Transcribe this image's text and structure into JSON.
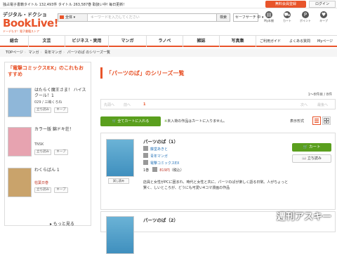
{
  "topbar": {
    "info": "独占電子書籍タイトル 132,493件 タイトル 263,587巻 取扱い中! 毎日更新!",
    "register": "無料会員登録",
    "login": "ログイン"
  },
  "header": {
    "logo_small": "デジタル・ドクショ",
    "logo_main": "BookLive!",
    "logo_sub": "ドーデもす！電子書籍ストア",
    "search_category": "全体",
    "search_placeholder": "キーワードを入力してください",
    "search_button": "検索",
    "safe_search": "セーフサーチ 中",
    "icons": [
      {
        "name": "My本棚",
        "glyph": "▤"
      },
      {
        "name": "カート",
        "glyph": "⛟"
      },
      {
        "name": "ポイント",
        "glyph": "P"
      },
      {
        "name": "キープ",
        "glyph": "♥"
      }
    ]
  },
  "nav": {
    "items": [
      "総合",
      "文芸",
      "ビジネス・実用",
      "マンガ",
      "ラノベ",
      "雑誌",
      "写真集"
    ],
    "guide": "ご利用ガイド",
    "faq": "よくある質問",
    "mypage": "Myページ"
  },
  "breadcrumb": [
    "TOPページ",
    "マンガ",
    "青年マンガ",
    "パーツのぱ のシリーズ一覧"
  ],
  "sidebar": {
    "title": "「電撃コミックスEX」のこれもおすすめ",
    "books": [
      {
        "title": "はたらく魔王さま！ ハイスクール！1",
        "meta": "029 / 三嶋くろね",
        "btn1": "立ち読み",
        "btn2": "キープ",
        "cover": "#8fb7d9"
      },
      {
        "title": "カラー版 錦ドキ荘！",
        "meta": "TNSK",
        "btn1": "立ち読み",
        "btn2": "キープ",
        "cover": "#e7a3b0"
      },
      {
        "title": "わくらばん 1",
        "meta": "枯葉日巻",
        "btn1": "立ち読み",
        "btn2": "キープ",
        "cover": "#c9a36b"
      }
    ],
    "more": "もっと見る"
  },
  "main": {
    "page_title": "「パーツのぱ」のシリーズ一覧",
    "count": "1～8件目 / 8件",
    "pager": [
      "先頭へ",
      "前へ",
      "1",
      "次へ",
      "最後へ"
    ],
    "cart_all": "全てカートに入れる",
    "note_star": "※",
    "note": "未入荷の作品はカートに入りません。",
    "display_label": "表示形式",
    "items": [
      {
        "title": "パーツのぱ（1）",
        "author": "藤堂あきと",
        "genre": "青年マンガ",
        "label": "電撃コミックスEX",
        "volume": "1巻",
        "price": "819円",
        "tax": "（税込）",
        "desc": "店員と女性がPCに囲まれ、時代と女性と共に、パーツのぱが楽しく語る日常。人がちょっと賢く、しいところが、どうにも可愛い4コマ漫画の作品",
        "cart": "カート",
        "read": "立ち読み",
        "sample": "試し読み"
      },
      {
        "title": "パーツのぱ（2）"
      }
    ]
  },
  "watermark": "週刊アスキー",
  "colors": {
    "accent": "#e8542a",
    "green": "#5a9f1e",
    "link": "#2673b8"
  }
}
